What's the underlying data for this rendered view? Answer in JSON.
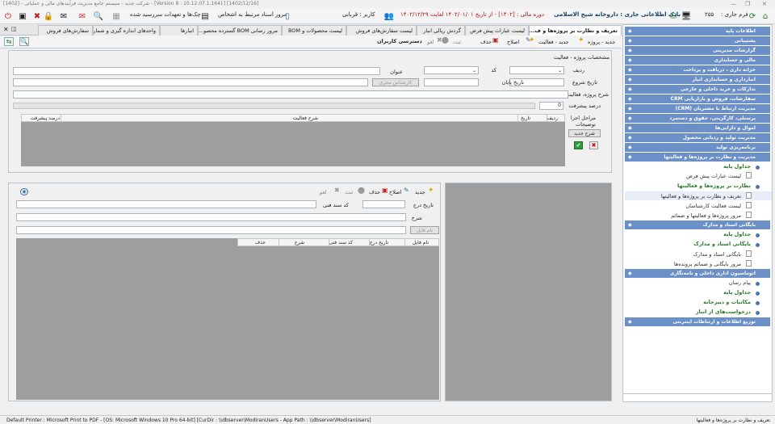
{
  "window": {
    "title": "شرکت جدید - سیستم جامع مدیریت فرآیندهای مالی و عملیاتی - [1402] - [Version 8 : 10.12.07.1.1641] [1402/12/16]"
  },
  "toolbar": {
    "form_label": "فرم جاری :",
    "form_number": "۲۵۵",
    "bank_label": "بانک اطلاعاتی جاری : داروخانه شیخ الاسلامی",
    "period_label": "دوره مالی : [۱۴۰۲] - از تاریخ ۱۴۰۲/۰۱/۰۱ لغایت ۱۴۰۲/۱۲/۲۹",
    "user_label": "کاربر : قربانی",
    "review_docs": "مرور اسناد مرتبط به اشخاص",
    "checks_due": "چک‌ها و تعهدات سررسید شده"
  },
  "tabs": [
    {
      "label": "تعریف و نظارت بر پروژه‌ها و ف...",
      "active": true
    },
    {
      "label": "لیست عبارات پیش فرض"
    },
    {
      "label": "گردش ریالی انبار"
    },
    {
      "label": "لیست سفارش‌های فروش"
    },
    {
      "label": "لیست محصولات و BOM"
    },
    {
      "label": "مرور رسانی BOM گسترده محصو..."
    },
    {
      "label": "انبارها"
    },
    {
      "label": "واحدهای اندازه گیری و شمارش..."
    },
    {
      "label": "سفارش‌های فروش"
    }
  ],
  "form_toolbar": {
    "new": "جدید",
    "new_project": "جدید - پروژه",
    "new_activity": "جدید - فعالیت",
    "edit": "اصلاح",
    "delete": "حذف",
    "save": "ثبت",
    "cancel": "لغو",
    "user_access": "دسترسی کاربران"
  },
  "form": {
    "section_title": "مشخصات پروژه - فعالیت",
    "row_label": "ردیف",
    "code_label": "کد",
    "title_label": "عنوان",
    "start_date_label": "تاریخ شروع",
    "end_date_label": "تاریخ پایان",
    "expert_button": "کارشناس مجری",
    "description_label": "شرح پروژه، فعالیت",
    "progress_label": "درصد پیشرفت",
    "progress_value": "0",
    "stages_label": "مراحل اجرا",
    "notes_label": "توضیحات",
    "new_desc_button": "شرح جدید",
    "grid_headers": [
      "ردیف",
      "تاریخ",
      "شرح فعالیت",
      "درصد پیشرفت"
    ]
  },
  "docs_panel": {
    "new": "جدید",
    "edit": "اصلاح",
    "delete": "حذف",
    "save": "ثبت",
    "cancel": "لغو",
    "date_label": "تاریخ درج",
    "tech_code_label": "کد سند فنی",
    "desc_label": "شرح",
    "file_button": "نام فایل",
    "grid_headers": [
      "نام فایل",
      "تاریخ درج",
      "کد سند فنی",
      "شرح",
      "حذف"
    ]
  },
  "sidebar": {
    "headers": [
      "اطلاعات پایه",
      "پشتیبانی",
      "گزارشات مدیریتی",
      "مالی و حسابداری",
      "خزانه داری ، دریافت و پرداخت",
      "انبارداری و حسابداری انبار",
      "تدارکات و خرید داخلی و خارجی",
      "سفارشات، فروش و بازاریابی CRM",
      "مدیریت ارتباط با مشتریان (CRM)",
      "پرسنلی، کارگزینی، حقوق و دستمزد",
      "اموال و دارایی‌ها",
      "مدیریت تولید و ردیابی محصول",
      "برنامه‌ریزی تولید",
      "مدیریت و نظارت بر پروژه‌ها و فعالیتها"
    ],
    "projects_sub1": "جداول پایه",
    "projects_item1": "لیست عبارات پیش فرض",
    "projects_sub2": "نظارت بر پروژه‌ها و فعالیتها",
    "projects_item2": "تعریف و نظارت بر پروژه‌ها و فعالیتها",
    "projects_item3": "لیست فعالیت کارشناسان",
    "projects_item4": "مرور پروژه‌ها و فعالیتها و ضمائم",
    "archive_header": "بایگانی اسناد و مدارک",
    "archive_sub1": "جداول پایه",
    "archive_sub2": "بایگانی اسناد و مدارک",
    "archive_item1": "بایگانی اسناد و مدارک",
    "archive_item2": "مرور بایگانی و ضمائم پرونده‌ها",
    "office_header": "اتوماسیون اداری داخلی و نامه‌نگاری",
    "office_item1": "پیام رسان",
    "office_item2": "جداول پایه",
    "office_item3": "مکاتبات و دبیرخانه",
    "office_item4": "درخواست‌های از انبار",
    "info_header": "توزیع اطلاعات و ارتباطات اینترنتی"
  },
  "status": {
    "left": "Default Printer : Microsoft Print to PDF - [OS: Microsoft Windows 10 Pro 64-bit]   [CurDir : \\\\dbserver\\ModiranUsers - App Path : \\\\dbserver\\ModiranUsers]",
    "right": "تعریف و نظارت بر پروژه‌ها و فعالیتها"
  },
  "colors": {
    "sidebar_header": "#6b8fc7",
    "sub_green": "#2a7a2a",
    "grid_gray": "#9e9e9e"
  }
}
